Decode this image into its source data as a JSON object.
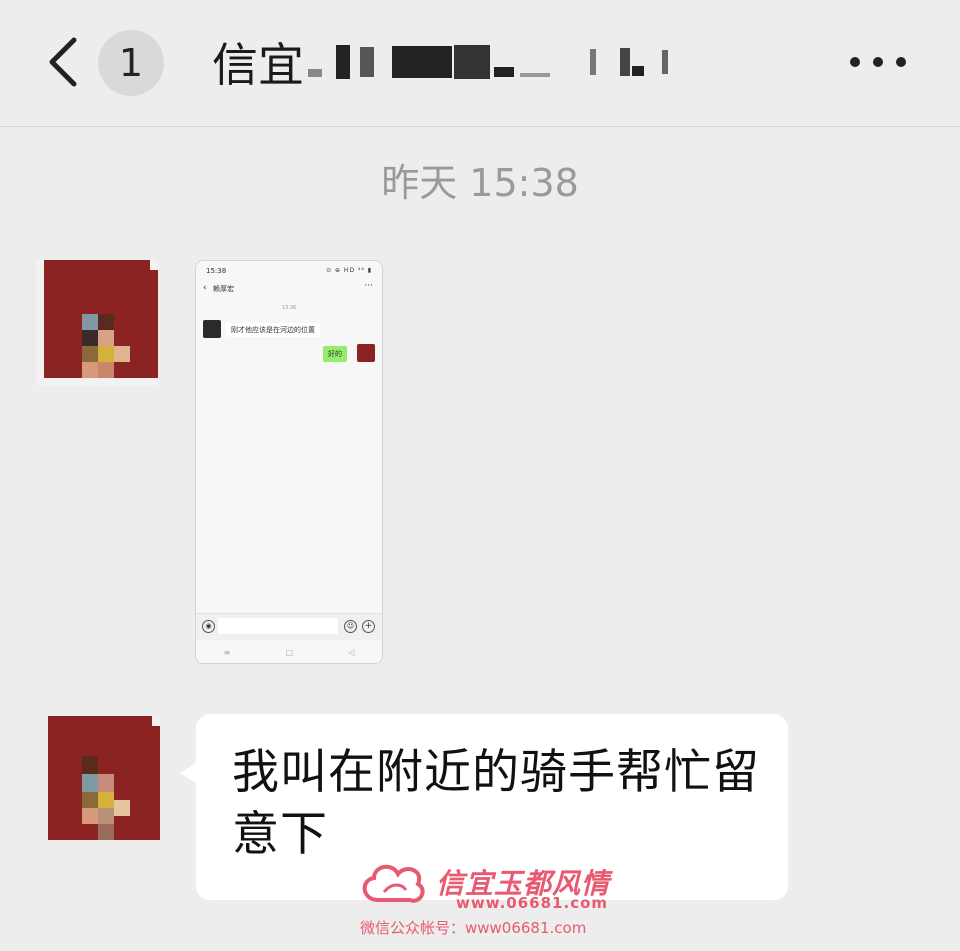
{
  "header": {
    "back_label": "返回",
    "unread_count": "1",
    "title_prefix": "信宜",
    "more_label": "更多"
  },
  "chat": {
    "timestamp": "昨天 15:38",
    "screenshot_message": {
      "status_time": "15:38",
      "status_icons": "⊙ ⊕ HD ⁴⁶ ▮",
      "contact_name": "赖厚宏",
      "time": "13:36",
      "incoming_text": "刚才他应该是在河边的位置",
      "outgoing_text": "好的",
      "nav": [
        "≡",
        "□",
        "◁"
      ]
    },
    "text_message": "我叫在附近的骑手帮忙留意下"
  },
  "watermark": {
    "name": "信宜玉都风情",
    "url": "www.06681.com",
    "line": "微信公众帐号：www06681.com"
  },
  "colors": {
    "background": "#ededed",
    "bubble": "#ffffff",
    "green_bubble": "#95ec69",
    "watermark": "#e85a71",
    "avatar_red": "#8b2323"
  }
}
